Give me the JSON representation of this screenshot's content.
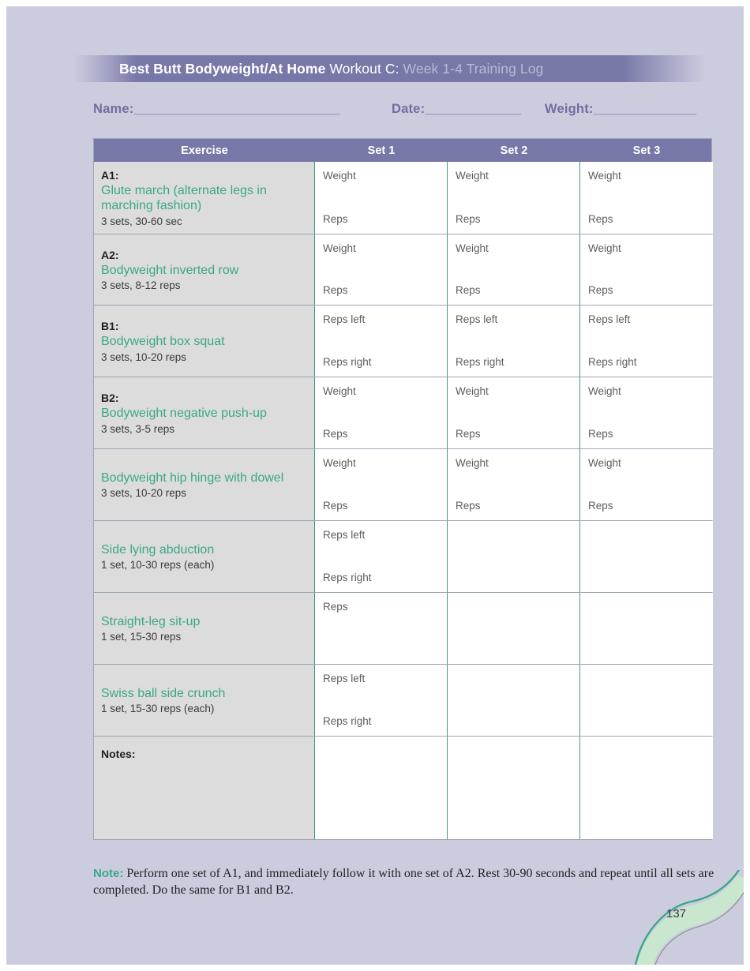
{
  "page": {
    "background_color": "#ccccdf",
    "page_number": "137"
  },
  "banner": {
    "title_bold": "Best Butt Bodyweight/At Home",
    "title_regular": " Workout C:",
    "title_muted": " Week 1-4 Training Log",
    "background_color": "#7878a8"
  },
  "meta": {
    "name_label": "Name:",
    "name_line": "______________________________",
    "date_label": "Date:",
    "date_line": "______________",
    "weight_label": "Weight:",
    "weight_line": "_______________"
  },
  "table": {
    "header_color": "#7878a8",
    "accent_color": "#3aa888",
    "columns": [
      "Exercise",
      "Set 1",
      "Set 2",
      "Set 3"
    ],
    "rows": [
      {
        "code": "A1:",
        "name": "Glute march (alternate legs in marching fashion)",
        "prescription": "3 sets, 30-60 sec",
        "sets": [
          {
            "top": "Weight",
            "bottom": "Reps"
          },
          {
            "top": "Weight",
            "bottom": "Reps"
          },
          {
            "top": "Weight",
            "bottom": "Reps"
          }
        ]
      },
      {
        "code": "A2:",
        "name": "Bodyweight inverted row",
        "prescription": "3 sets, 8-12 reps",
        "sets": [
          {
            "top": "Weight",
            "bottom": "Reps"
          },
          {
            "top": "Weight",
            "bottom": "Reps"
          },
          {
            "top": "Weight",
            "bottom": "Reps"
          }
        ]
      },
      {
        "code": "B1:",
        "name": "Bodyweight box squat",
        "prescription": "3 sets, 10-20 reps",
        "sets": [
          {
            "top": "Reps left",
            "bottom": "Reps right"
          },
          {
            "top": "Reps left",
            "bottom": "Reps right"
          },
          {
            "top": "Reps left",
            "bottom": "Reps right"
          }
        ]
      },
      {
        "code": "B2:",
        "name": "Bodyweight negative push-up",
        "prescription": "3 sets, 3-5 reps",
        "sets": [
          {
            "top": "Weight",
            "bottom": "Reps"
          },
          {
            "top": "Weight",
            "bottom": "Reps"
          },
          {
            "top": "Weight",
            "bottom": "Reps"
          }
        ]
      },
      {
        "code": "",
        "name": "Bodyweight hip hinge with dowel",
        "prescription": "3 sets, 10-20 reps",
        "sets": [
          {
            "top": "Weight",
            "bottom": "Reps"
          },
          {
            "top": "Weight",
            "bottom": "Reps"
          },
          {
            "top": "Weight",
            "bottom": "Reps"
          }
        ]
      },
      {
        "code": "",
        "name": "Side lying abduction",
        "prescription": "1 set, 10-30 reps (each)",
        "sets": [
          {
            "top": "Reps left",
            "bottom": "Reps right"
          },
          {
            "top": "",
            "bottom": ""
          },
          {
            "top": "",
            "bottom": ""
          }
        ]
      },
      {
        "code": "",
        "name": "Straight-leg sit-up",
        "prescription": "1 set, 15-30 reps",
        "sets": [
          {
            "top": "Reps",
            "bottom": ""
          },
          {
            "top": "",
            "bottom": ""
          },
          {
            "top": "",
            "bottom": ""
          }
        ]
      },
      {
        "code": "",
        "name": "Swiss ball side crunch",
        "prescription": "1 set, 15-30 reps (each)",
        "sets": [
          {
            "top": "Reps left",
            "bottom": "Reps right"
          },
          {
            "top": "",
            "bottom": ""
          },
          {
            "top": "",
            "bottom": ""
          }
        ]
      }
    ],
    "notes_label": "Notes:"
  },
  "footnote": {
    "label": "Note:",
    "text": " Perform one set of A1, and immediately follow it with one set of A2. Rest 30-90 seconds and repeat until all sets are completed. Do the same for B1 and B2."
  }
}
